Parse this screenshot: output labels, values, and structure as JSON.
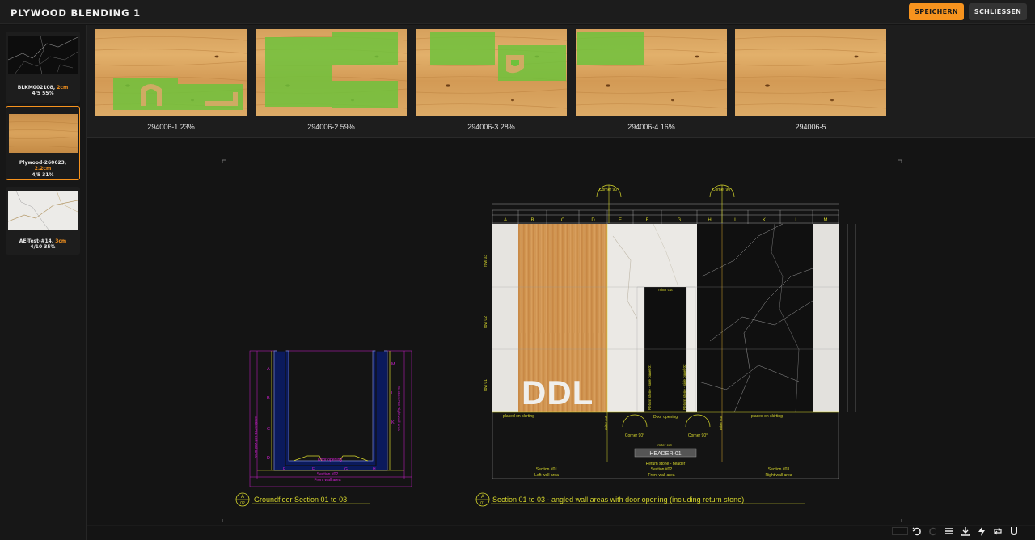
{
  "app": {
    "title": "PLYWOOD BLENDING 1"
  },
  "header": {
    "save_label": "SPEICHERN",
    "close_label": "SCHLIESSEN"
  },
  "sidebar": {
    "materials": [
      {
        "name": "BLKM002108,",
        "thickness": "2cm",
        "stats": "4/5 55%",
        "active": false
      },
      {
        "name": "Plywood-260623,",
        "thickness": "2.2cm",
        "stats": "4/5 31%",
        "active": true
      },
      {
        "name": "AE-Test-#14,",
        "thickness": "3cm",
        "stats": "4/10 35%",
        "active": false
      }
    ]
  },
  "sheets": [
    {
      "label": "294006-1 23%"
    },
    {
      "label": "294006-2 59%"
    },
    {
      "label": "294006-3 28%"
    },
    {
      "label": "294006-4 16%"
    },
    {
      "label": "294006-5"
    }
  ],
  "drawing": {
    "section_a02": {
      "number": "A",
      "sub": "02",
      "title": "Groundfloor Section 01 to 03"
    },
    "section_a01": {
      "number": "A",
      "sub": "01",
      "title": "Section 01 to 03 - angled wall areas with door opening (including return stone)"
    },
    "column_letters": [
      "A",
      "B",
      "C",
      "D",
      "E",
      "F",
      "G",
      "H",
      "I",
      "K",
      "L",
      "M"
    ],
    "row_labels": [
      "row 03",
      "row 02",
      "row 01"
    ],
    "corner_label": "Corner 90°",
    "miter_cut": "miter cut",
    "placed_on_skirting": "placed on skirting",
    "door_opening": "Door opening",
    "header_label": "HEADER-01",
    "return_stone_header": "Return stone - header",
    "return_side_1": "Return stone - side panel 01",
    "return_side_2": "Return stone - side panel 02",
    "logo_text": "DDL",
    "sections": [
      {
        "name": "Section #01",
        "area": "Left wall area"
      },
      {
        "name": "Section #02",
        "area": "Front wall area"
      },
      {
        "name": "Section #03",
        "area": "Right wall area"
      }
    ],
    "plan_letters_left": [
      "A",
      "B",
      "C",
      "D"
    ],
    "plan_letters_bottom": [
      "E",
      "F",
      "G",
      "H"
    ],
    "plan_letters_right": [
      "M",
      "L",
      "K"
    ],
    "plan_left_caption": "Section #01 Left wall area",
    "plan_right_caption": "Section #03 Right wall area",
    "plan_door": "Door opening",
    "plan_front_1": "Section #02",
    "plan_front_2": "Front wall area"
  },
  "toolbar": {
    "icons": [
      "undo-icon",
      "redo-icon",
      "menu-icon",
      "download-icon",
      "flash-icon",
      "repeat-icon",
      "magnet-icon"
    ]
  },
  "colors": {
    "accent": "#f7931e",
    "cad_yellow": "#e8e82a",
    "cad_magenta": "#d21fd2",
    "green_overlay": "#6ec23c"
  }
}
